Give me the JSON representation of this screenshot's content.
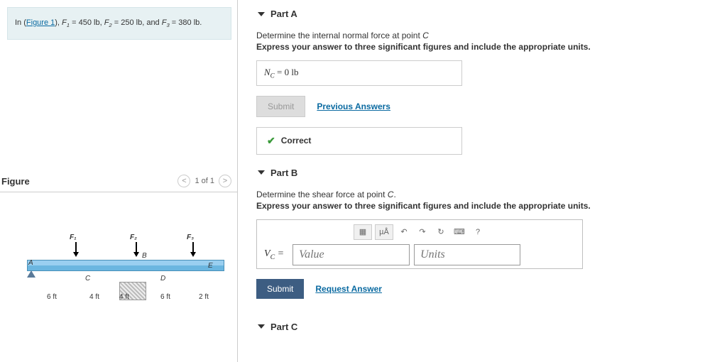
{
  "problemStatement": {
    "prefix": "In (",
    "figureLink": "Figure 1",
    "body": "), F₁ = 450 lb, F₂ = 250 lb, and F₃ = 380 lb."
  },
  "figurePanel": {
    "title": "Figure",
    "pager": "1 of 1",
    "forces": [
      "F₁",
      "F₂",
      "F₃"
    ],
    "points": [
      "A",
      "B",
      "C",
      "D",
      "E"
    ],
    "dims": [
      "6 ft",
      "4 ft",
      "4 ft",
      "6 ft",
      "2 ft"
    ]
  },
  "common": {
    "instructions": "Express your answer to three significant figures and include the appropriate units.",
    "submitLabel": "Submit",
    "prevAnswersLabel": "Previous Answers",
    "requestAnswerLabel": "Request Answer",
    "correctLabel": "Correct",
    "valuePlaceholder": "Value",
    "unitsPlaceholder": "Units",
    "helpLabel": "?"
  },
  "parts": {
    "A": {
      "title": "Part A",
      "prompt": "Determine the internal normal force at point C",
      "answerVar": "N_C",
      "answerValue": "0 lb",
      "submitDisabled": true,
      "correct": true
    },
    "B": {
      "title": "Part B",
      "prompt": "Determine the shear force at point C.",
      "answerVar": "V_C"
    },
    "C": {
      "title": "Part C"
    }
  },
  "toolbarItems": {
    "fraction": "▦",
    "units": "µÅ",
    "undo": "↶",
    "redo": "↷",
    "reset": "↻",
    "keyboard": "⌨"
  }
}
